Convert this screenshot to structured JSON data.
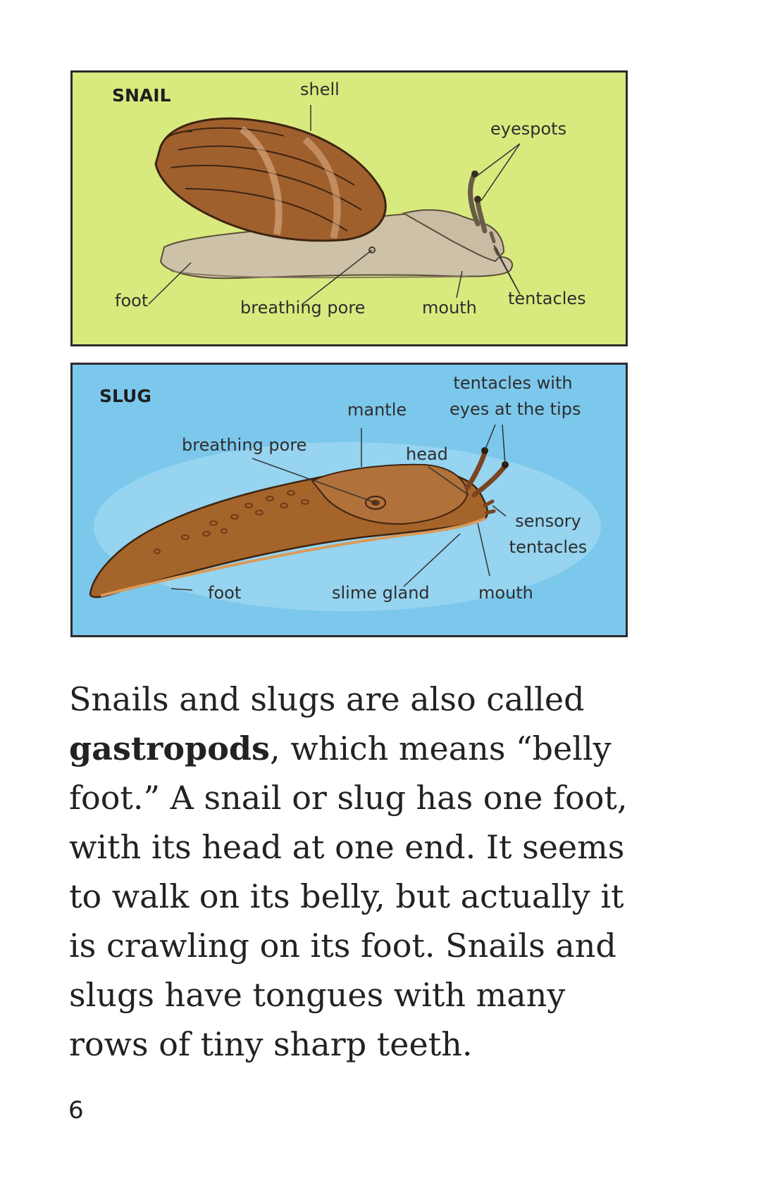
{
  "snail_diagram": {
    "title": "SNAIL",
    "labels": {
      "shell": "shell",
      "eyespots": "eyespots",
      "foot": "foot",
      "breathing_pore": "breathing pore",
      "mouth": "mouth",
      "tentacles": "tentacles"
    },
    "colors": {
      "background": "#d8ea7e",
      "shell": "#a0602e",
      "body": "#cdc2a8"
    }
  },
  "slug_diagram": {
    "title": "SLUG",
    "labels": {
      "mantle": "mantle",
      "tentacles_with_eyes_line1": "tentacles with",
      "tentacles_with_eyes_line2": "eyes at the tips",
      "breathing_pore": "breathing pore",
      "head": "head",
      "sensory_tentacles_line1": "sensory",
      "sensory_tentacles_line2": "tentacles",
      "foot": "foot",
      "slime_gland": "slime gland",
      "mouth": "mouth"
    },
    "colors": {
      "background": "#7cc8ec",
      "body": "#a5642a"
    }
  },
  "body": {
    "part1": "Snails and slugs are also called ",
    "bold_term": "gastropods",
    "part2": ", which means “belly foot.” A snail or slug has one foot, with its head at one end. It seems to walk on its belly, but actually it is crawling on its foot. Snails and slugs have tongues with many rows of tiny sharp teeth."
  },
  "page_number": "6"
}
